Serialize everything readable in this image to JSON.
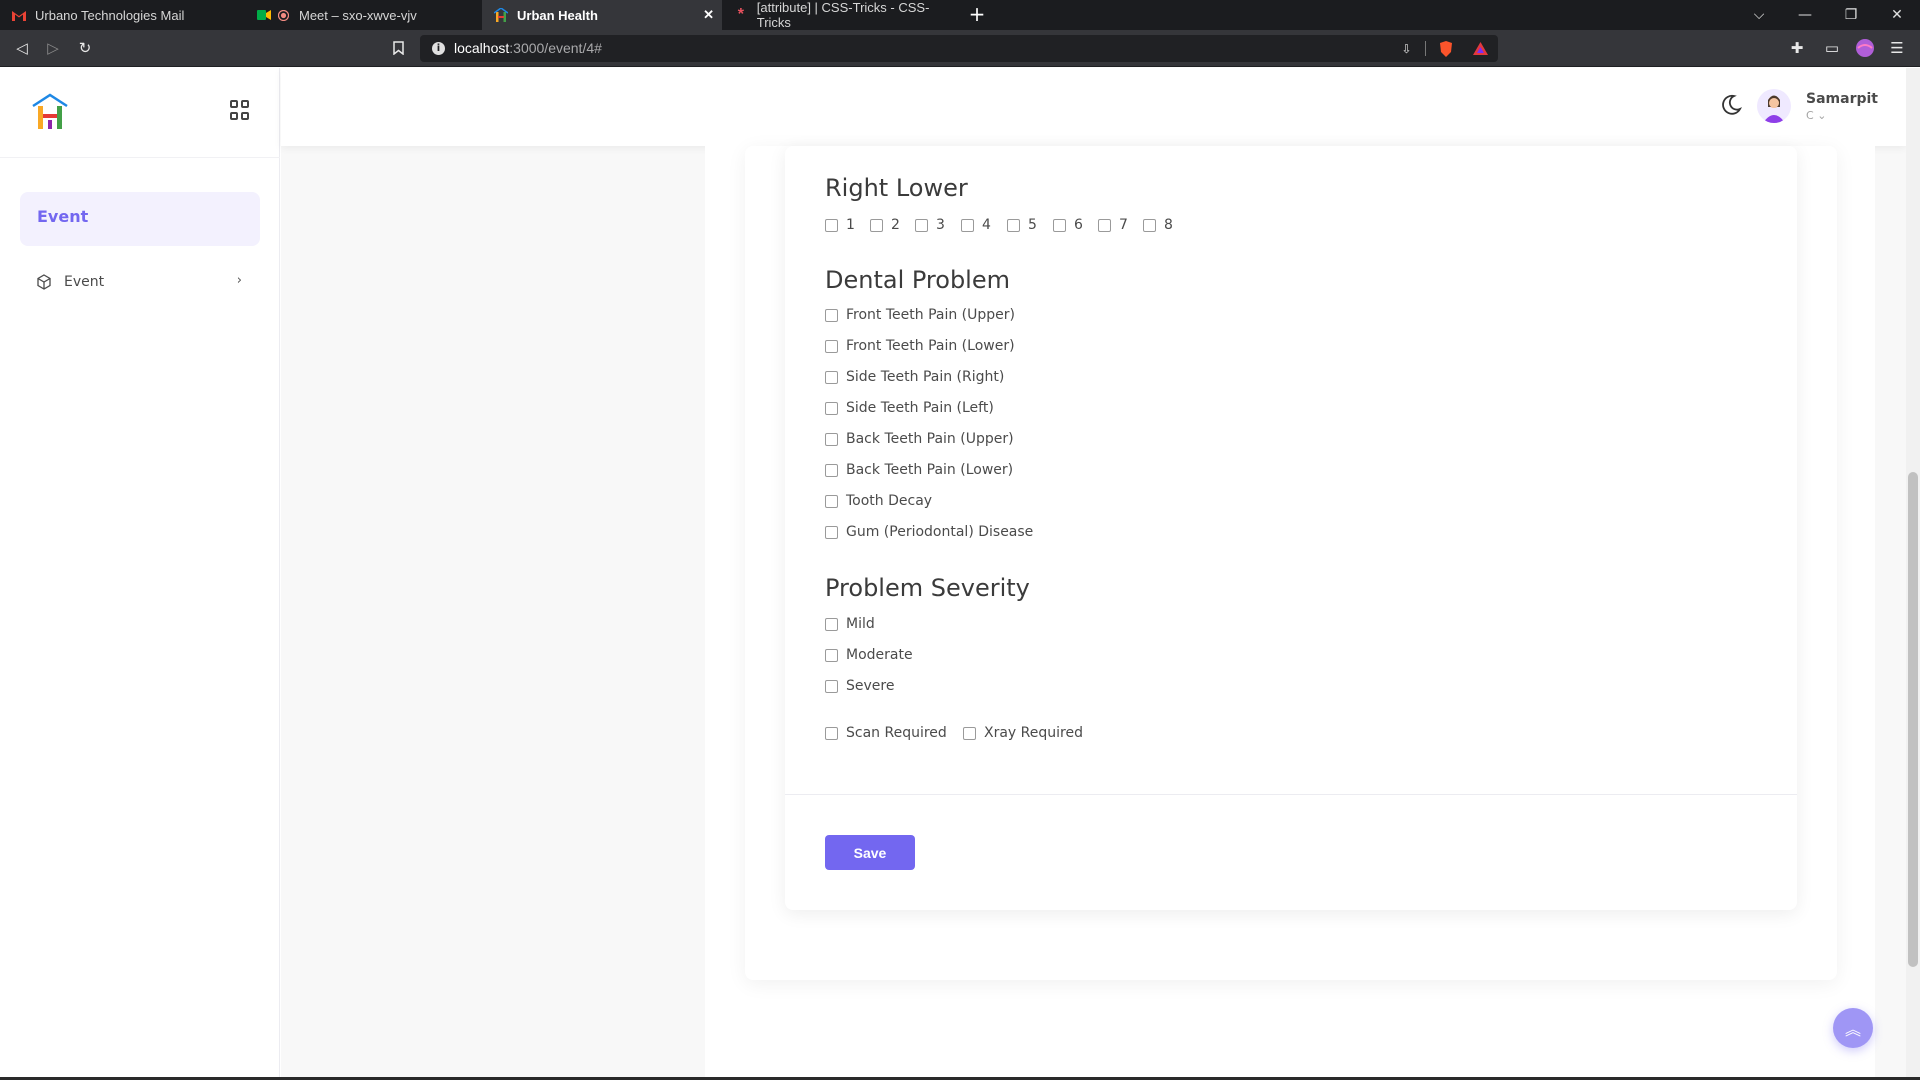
{
  "browser": {
    "tabs": [
      {
        "title": "Urbano Technologies Mail",
        "icon": "gmail-icon"
      },
      {
        "title": "Meet – sxo-xwve-vjv",
        "icon": "meet-icon"
      },
      {
        "title": "Urban Health",
        "icon": "urban-health-icon"
      },
      {
        "title": "[attribute] | CSS-Tricks - CSS-Tricks",
        "icon": "css-tricks-icon"
      }
    ],
    "url_host": "localhost",
    "url_path": ":3000/event/4#"
  },
  "sidebar": {
    "active_label": "Event",
    "items": [
      {
        "label": "Event",
        "icon": "cube-icon"
      }
    ]
  },
  "header": {
    "user_name": "Samarpit",
    "user_role": "C"
  },
  "form": {
    "right_lower": {
      "title": "Right Lower",
      "options": [
        "1",
        "2",
        "3",
        "4",
        "5",
        "6",
        "7",
        "8"
      ]
    },
    "dental_problem": {
      "title": "Dental Problem",
      "options": [
        "Front Teeth Pain (Upper)",
        "Front Teeth Pain (Lower)",
        "Side Teeth Pain (Right)",
        "Side Teeth Pain (Left)",
        "Back Teeth Pain (Upper)",
        "Back Teeth Pain (Lower)",
        "Tooth Decay",
        "Gum (Periodontal) Disease"
      ]
    },
    "severity": {
      "title": "Problem Severity",
      "options": [
        "Mild",
        "Moderate",
        "Severe"
      ]
    },
    "extra": [
      "Scan Required",
      "Xray Required"
    ],
    "save_label": "Save"
  },
  "colors": {
    "accent": "#7367f0",
    "active_bg": "#f3f1fe"
  }
}
